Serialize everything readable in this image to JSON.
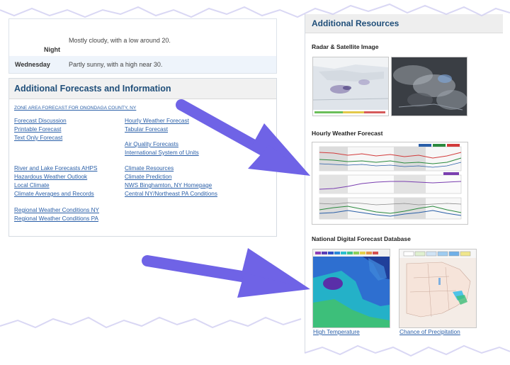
{
  "forecast": {
    "rows": [
      {
        "period": "Night",
        "text": "Mostly cloudy, with a low around 20."
      },
      {
        "period": "Wednesday",
        "text": "Partly sunny, with a high near 30."
      }
    ]
  },
  "additional": {
    "title": "Additional Forecasts and Information",
    "zone_link": "ZONE AREA FORECAST FOR ONONDAGA COUNTY, NY",
    "left_links": [
      "Forecast Discussion",
      "Printable Forecast",
      "Text Only Forecast",
      "River and Lake Forecasts AHPS",
      "Hazardous Weather Outlook",
      "Local Climate",
      "Climate Averages and Records",
      "Regional Weather Conditions NY",
      "Regional Weather Conditions PA"
    ],
    "right_links": [
      "Hourly Weather Forecast",
      "Tabular Forecast",
      "Air Quality Forecasts",
      "International System of Units",
      "Climate Resources",
      "Climate Prediction",
      "NWS Binghamton, NY Homepage",
      "Central NY/Northeast PA Conditions"
    ]
  },
  "resources": {
    "title": "Additional Resources",
    "radar_title": "Radar & Satellite Image",
    "hourly_title": "Hourly Weather Forecast",
    "ndfd_title": "National Digital Forecast Database",
    "ndfd_links": [
      "High Temperature",
      "Chance of Precipitation"
    ]
  },
  "colors": {
    "accent_arrow": "#6f63e6",
    "heading_blue": "#1f4e79",
    "link_blue": "#2a5fa8"
  }
}
